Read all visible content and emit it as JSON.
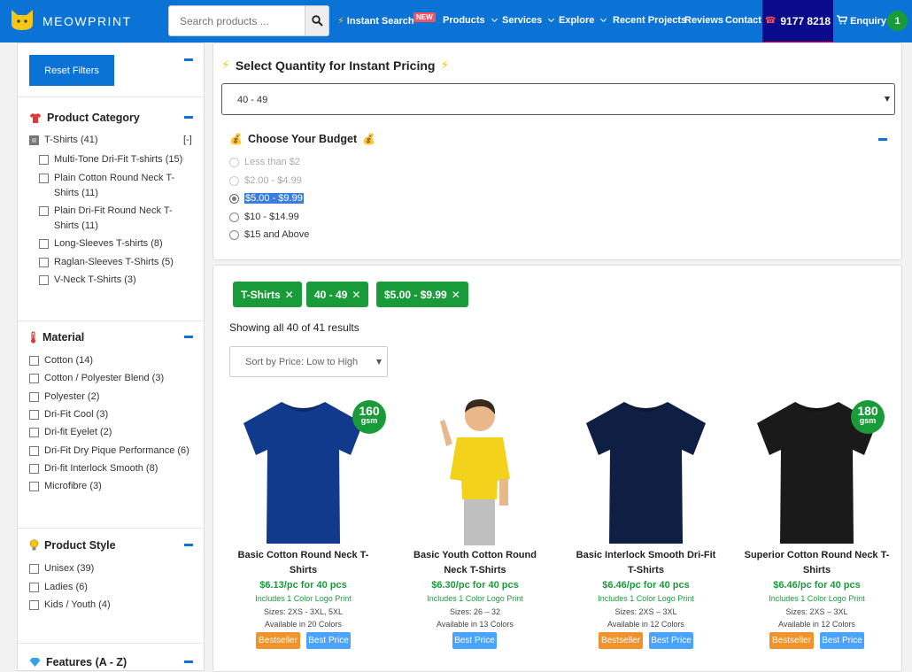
{
  "nav": {
    "brand": "MEOWPRINT",
    "search_placeholder": "Search products ...",
    "menu": {
      "instant": "Instant Search",
      "instant_badge": "NEW",
      "products": "Products",
      "services": "Services",
      "explore": "Explore",
      "recent": "Recent Projects",
      "reviews": "Reviews",
      "contact": "Contact"
    },
    "phone": "9177 8218",
    "enquiry": "Enquiry",
    "enquiry_count": "1"
  },
  "sidebar": {
    "reset_label": "Reset Filters",
    "category": {
      "title": "Product Category",
      "parent": "T-Shirts (41)",
      "collapse": "[-]",
      "items": [
        [
          "Multi-Tone Dri-Fit T-shirts (15)"
        ],
        [
          "Plain Cotton Round Neck T-",
          "Shirts (11)"
        ],
        [
          "Plain Dri-Fit Round Neck T-",
          "Shirts (11)"
        ],
        [
          "Long-Sleeves T-shirts (8)"
        ],
        [
          "Raglan-Sleeves T-Shirts (5)"
        ],
        [
          "V-Neck T-Shirts (3)"
        ]
      ]
    },
    "material": {
      "title": "Material",
      "items": [
        "Cotton (14)",
        "Cotton / Polyester Blend (3)",
        "Polyester (2)",
        "Dri-Fit Cool (3)",
        "Dri-fit Eyelet (2)",
        "Dri-Fit Dry Pique Performance (6)",
        "Dri-fit Interlock Smooth (8)",
        "Microfibre (3)"
      ]
    },
    "style": {
      "title": "Product Style",
      "items": [
        "Unisex (39)",
        "Ladies (6)",
        "Kids / Youth (4)"
      ]
    },
    "features": {
      "title": "Features (A - Z)"
    }
  },
  "pricing": {
    "quantity_title": "Select Quantity for Instant Pricing",
    "quantity_value": "40 - 49",
    "budget_title": "Choose Your Budget",
    "budget_options": [
      "Less than $2",
      "$2.00 - $4.99",
      "$5.00 - $9.99",
      "$10 - $14.99",
      "$15 and Above"
    ],
    "budget_selected": 2
  },
  "results": {
    "chips": [
      "T-Shirts",
      "40 - 49",
      "$5.00 - $9.99"
    ],
    "showing": "Showing all 40 of 41 results",
    "sort_value": "Sort by Price: Low to High",
    "products": [
      {
        "name1": "Basic Cotton Round Neck T-",
        "name2": "Shirts",
        "price": "$6.13/pc for 40 pcs",
        "logo": "Includes 1 Color Logo Print",
        "sizes": "Sizes: 2XS - 3XL, 5XL",
        "colors": "Available in 20 Colors",
        "gsm": "160",
        "gsm_unit": "gsm",
        "tags": [
          "Bestseller",
          "Best Price"
        ],
        "color": "#123a8c"
      },
      {
        "name1": "Basic Youth Cotton Round",
        "name2": "Neck T-Shirts",
        "price": "$6.30/pc for 40 pcs",
        "logo": "Includes 1 Color Logo Print",
        "sizes": "Sizes: 26 – 32",
        "colors": "Available in 13 Colors",
        "tags": [
          "Best Price"
        ],
        "color": "#f3d21c"
      },
      {
        "name1": "Basic Interlock Smooth Dri-Fit",
        "name2": "T-Shirts",
        "price": "$6.46/pc for 40 pcs",
        "logo": "Includes 1 Color Logo Print",
        "sizes": "Sizes: 2XS – 3XL",
        "colors": "Available in 12 Colors",
        "tags": [
          "Bestseller",
          "Best Price"
        ],
        "color": "#0f1f44"
      },
      {
        "name1": "Superior Cotton Round Neck T-",
        "name2": "Shirts",
        "price": "$6.46/pc for 40 pcs",
        "logo": "Includes 1 Color Logo Print",
        "sizes": "Sizes: 2XS – 3XL",
        "colors": "Available in 12 Colors",
        "gsm": "180",
        "gsm_unit": "gsm",
        "tags": [
          "Bestseller",
          "Best Price"
        ],
        "color": "#1a1a1a"
      }
    ]
  }
}
